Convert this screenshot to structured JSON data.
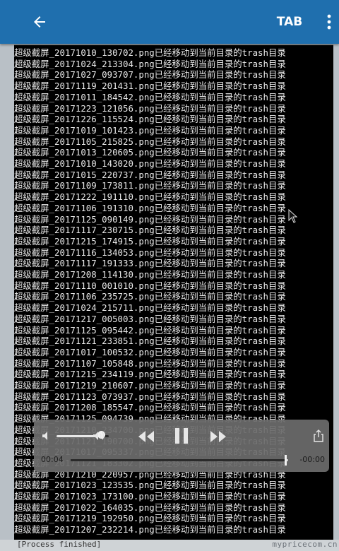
{
  "appbar": {
    "tab_label": "TAB",
    "color": "#1f6fae"
  },
  "terminal": {
    "lines": [
      "超级截屏_20171010_130702.png已经移动到当前目录的trash目录",
      "超级截屏_20171024_213304.png已经移动到当前目录的trash目录",
      "超级截屏_20171027_093707.png已经移动到当前目录的trash目录",
      "超级截屏_20171119_201431.png已经移动到当前目录的trash目录",
      "超级截屏_20171011_184542.png已经移动到当前目录的trash目录",
      "超级截屏_20171223_121056.png已经移动到当前目录的trash目录",
      "超级截屏_20171226_115524.png已经移动到当前目录的trash目录",
      "超级截屏_20171019_101423.png已经移动到当前目录的trash目录",
      "超级截屏_20171105_215825.png已经移动到当前目录的trash目录",
      "超级截屏_20171013_120605.png已经移动到当前目录的trash目录",
      "超级截屏_20171010_143020.png已经移动到当前目录的trash目录",
      "超级截屏_20171015_220737.png已经移动到当前目录的trash目录",
      "超级截屏_20171109_173811.png已经移动到当前目录的trash目录",
      "超级截屏_20171222_191110.png已经移动到当前目录的trash目录",
      "超级截屏_20171106_191310.png已经移动到当前目录的trash目录",
      "超级截屏_20171125_090149.png已经移动到当前目录的trash目录",
      "超级截屏_20171117_230715.png已经移动到当前目录的trash目录",
      "超级截屏_20171215_174915.png已经移动到当前目录的trash目录",
      "超级截屏_20171116_134053.png已经移动到当前目录的trash目录",
      "超级截屏_20171117_191333.png已经移动到当前目录的trash目录",
      "超级截屏_20171208_114130.png已经移动到当前目录的trash目录",
      "超级截屏_20171110_001010.png已经移动到当前目录的trash目录",
      "超级截屏_20171106_235725.png已经移动到当前目录的trash目录",
      "超级截屏_20171024_215711.png已经移动到当前目录的trash目录",
      "超级截屏_20171217_005003.png已经移动到当前目录的trash目录",
      "超级截屏_20171125_095442.png已经移动到当前目录的trash目录",
      "超级截屏_20171121_233851.png已经移动到当前目录的trash目录",
      "超级截屏_20171017_100532.png已经移动到当前目录的trash目录",
      "超级截屏_20171107_105848.png已经移动到当前目录的trash目录",
      "超级截屏_20171215_234119.png已经移动到当前目录的trash目录",
      "超级截屏_20171219_210607.png已经移动到当前目录的trash目录",
      "超级截屏_20171123_073937.png已经移动到当前目录的trash目录",
      "超级截屏_20171208_185547.png已经移动到当前目录的trash目录",
      "超级截屏_20171125_094739.png已经移动到当前目录的trash目录",
      "超级截屏_20171210_234700.png已经移动到当前目录的trash目录",
      "超级截屏_20171121_190700.png已经移动到当前目录的trash目录",
      "超级截屏_20171017_095337.png已经移动到当前目录的trash目录",
      "超级截屏_20171121_183302.png已经移动到当前目录的trash目录",
      "超级截屏_20171210_220957.png已经移动到当前目录的trash目录",
      "超级截屏_20171023_123535.png已经移动到当前目录的trash目录",
      "超级截屏_20171023_173100.png已经移动到当前目录的trash目录",
      "超级截屏_20171022_164035.png已经移动到当前目录的trash目录",
      "超级截屏_20171219_192950.png已经移动到当前目录的trash目录",
      "超级截屏_20171207_232214.png已经移动到当前目录的trash目录"
    ]
  },
  "player": {
    "elapsed": "00:04",
    "remaining": "-00:00",
    "progress_fraction": 0.99,
    "volume_fraction": 0.85
  },
  "footer": {
    "watermark": "mypricecom.cn",
    "prompt_text": "[Process finished]"
  }
}
